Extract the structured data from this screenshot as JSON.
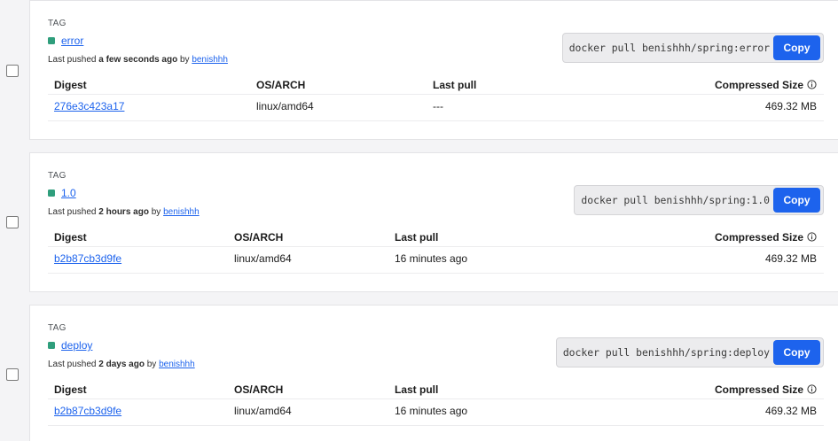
{
  "columns": {
    "digest": "Digest",
    "os_arch": "OS/ARCH",
    "last_pull": "Last pull",
    "compressed_size": "Compressed Size"
  },
  "tag_heading": "TAG",
  "copy_label": "Copy",
  "tags": [
    {
      "name": "error",
      "pushed_prefix": "Last pushed ",
      "pushed_when": "a few seconds ago",
      "pushed_by": " by ",
      "user": "benishhh",
      "pull_command": "docker pull benishhh/spring:error",
      "digest": "276e3c423a17",
      "os_arch": "linux/amd64",
      "last_pull": "---",
      "size": "469.32 MB"
    },
    {
      "name": "1.0",
      "pushed_prefix": "Last pushed ",
      "pushed_when": "2 hours ago",
      "pushed_by": " by ",
      "user": "benishhh",
      "pull_command": "docker pull benishhh/spring:1.0",
      "digest": "b2b87cb3d9fe",
      "os_arch": "linux/amd64",
      "last_pull": "16 minutes ago",
      "size": "469.32 MB"
    },
    {
      "name": "deploy",
      "pushed_prefix": "Last pushed ",
      "pushed_when": "2 days ago",
      "pushed_by": " by ",
      "user": "benishhh",
      "pull_command": "docker pull benishhh/spring:deploy",
      "digest": "b2b87cb3d9fe",
      "os_arch": "linux/amd64",
      "last_pull": "16 minutes ago",
      "size": "469.32 MB"
    }
  ]
}
